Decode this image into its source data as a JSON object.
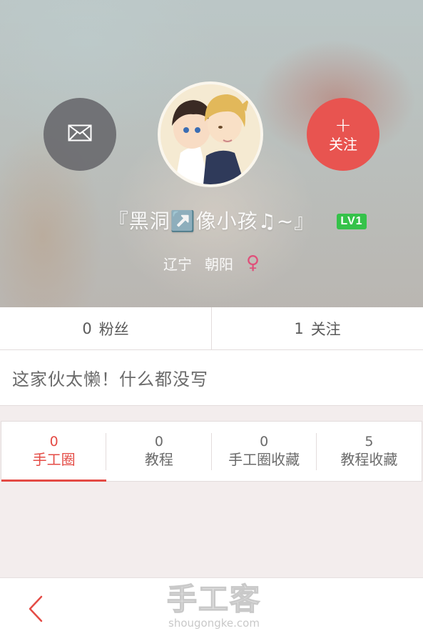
{
  "profile": {
    "nickname": "『黑洞↗️像小孩♫~』",
    "level": "LV1",
    "province": "辽宁",
    "city": "朝阳",
    "gender_icon": "female-icon",
    "gender_symbol": "♀"
  },
  "actions": {
    "message_icon": "envelope-icon",
    "follow_plus": "+",
    "follow_label": "关注"
  },
  "stats": {
    "fans_count": "0",
    "fans_label": "粉丝",
    "following_count": "1",
    "following_label": "关注"
  },
  "bio": {
    "text": "这家伙太懒！什么都没写"
  },
  "tabs": [
    {
      "count": "0",
      "label": "手工圈",
      "active": true
    },
    {
      "count": "0",
      "label": "教程",
      "active": false
    },
    {
      "count": "0",
      "label": "手工圈收藏",
      "active": false
    },
    {
      "count": "5",
      "label": "教程收藏",
      "active": false
    }
  ],
  "bottom_bar": {
    "back_icon": "chevron-left-icon",
    "watermark_main": "手工客",
    "watermark_sub": "shougongke.com"
  },
  "colors": {
    "accent_red": "#e44b45",
    "follow_red": "#e85450",
    "level_green": "#35c24a",
    "gender_pink": "#e0507a",
    "message_gray": "#646468"
  }
}
